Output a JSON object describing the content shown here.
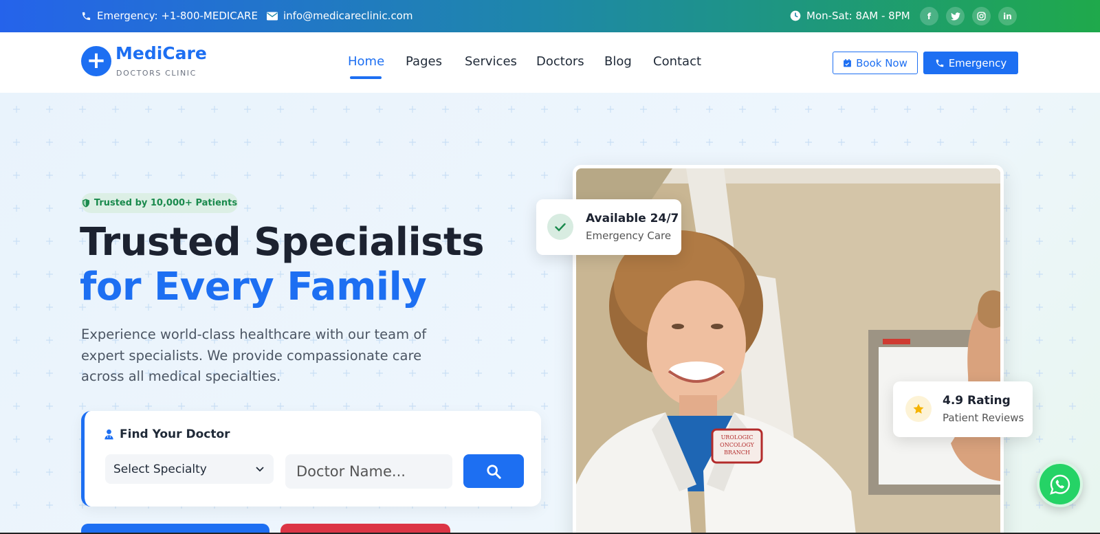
{
  "topbar": {
    "phone_label": "Emergency: +1-800-MEDICARE",
    "email_label": "info@medicareclinic.com",
    "hours_label": "Mon-Sat: 8AM - 8PM",
    "socials": [
      {
        "icon": "facebook-icon",
        "glyph": "f"
      },
      {
        "icon": "twitter-icon",
        "glyph": "t"
      },
      {
        "icon": "instagram-icon",
        "glyph": "◎"
      },
      {
        "icon": "linkedin-icon",
        "glyph": "in"
      }
    ]
  },
  "brand": {
    "name": "MediCare",
    "tagline": "DOCTORS CLINIC",
    "primary_color": "#1d6ff2"
  },
  "nav": {
    "items": [
      "Home",
      "Pages",
      "Services",
      "Doctors",
      "Blog",
      "Contact"
    ],
    "active": "Home",
    "book_label": "Book Now",
    "emergency_label": "Emergency"
  },
  "hero": {
    "badge": "Trusted by 10,000+ Patients",
    "title_line1": "Trusted Specialists",
    "title_line2": "for Every Family",
    "lead": "Experience world-class healthcare with our team of expert specialists. We provide compassionate care across all medical specialties."
  },
  "finder": {
    "title": "Find Your Doctor",
    "specialty_selected": "Select Specialty",
    "doctor_placeholder": "Doctor Name..."
  },
  "cards": {
    "availability_title": "Available 24/7",
    "availability_sub": "Emergency Care",
    "rating_title": "4.9 Rating",
    "rating_sub": "Patient Reviews"
  },
  "photo": {
    "coat_patch": [
      "UROLOGIC",
      "ONCOLOGY",
      "BRANCH"
    ]
  },
  "colors": {
    "accent": "#1d6ff2",
    "success": "#1a8a4d",
    "danger": "#dc3545",
    "whatsapp": "#25d366"
  }
}
